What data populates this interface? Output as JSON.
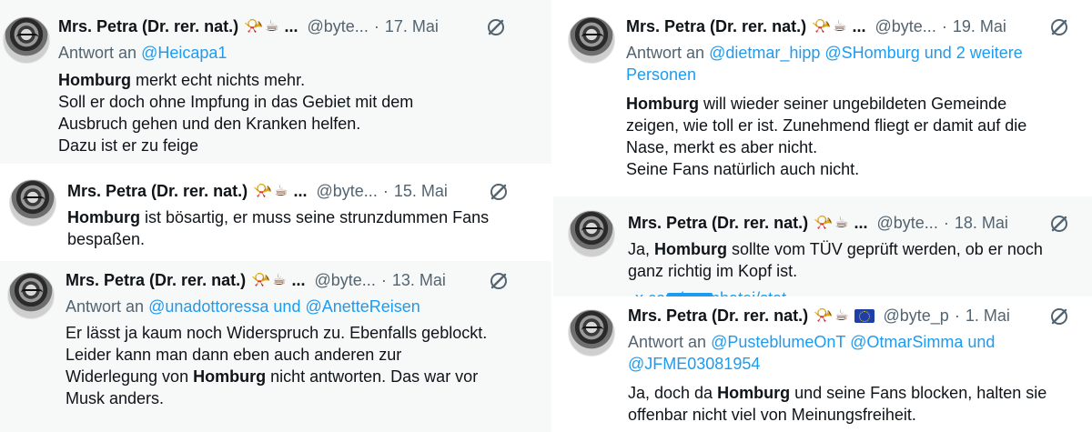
{
  "tweets": [
    {
      "name": "Mrs. Petra (Dr. rer. nat.)",
      "handle": "@byte...",
      "date": "17. Mai",
      "reply_prefix": "Antwort an",
      "reply_to": "@Heicapa1",
      "lines": [
        {
          "bold": "Homburg",
          "rest": " merkt echt nichts mehr."
        },
        {
          "bold": "",
          "rest": "Soll er doch ohne Impfung in das Gebiet mit dem"
        },
        {
          "bold": "",
          "rest": "Ausbruch gehen und den Kranken helfen."
        },
        {
          "bold": "",
          "rest": "Dazu ist er zu feige"
        }
      ]
    },
    {
      "name": "Mrs. Petra (Dr. rer. nat.)",
      "handle": "@byte...",
      "date": "15. Mai",
      "lines": [
        {
          "bold": "Homburg",
          "rest": " ist bösartig, er muss seine strunzdummen Fans"
        },
        {
          "bold": "",
          "rest": "bespaßen."
        }
      ]
    },
    {
      "name": "Mrs. Petra (Dr. rer. nat.)",
      "handle": "@byte...",
      "date": "13. Mai",
      "reply_prefix": "Antwort an",
      "reply_to": "@unadottoressa und @AnetteReisen",
      "lines": [
        {
          "pre": "Er lässt ja kaum noch Widerspruch zu. Ebenfalls geblockt.",
          "bold": "",
          "rest": ""
        },
        {
          "pre": "Leider kann man dann eben auch anderen zur",
          "bold": "",
          "rest": ""
        },
        {
          "pre": "Widerlegung von ",
          "bold": "Homburg",
          "rest": " nicht antworten. Das war vor"
        },
        {
          "pre": "Musk anders.",
          "bold": "",
          "rest": ""
        }
      ]
    },
    {
      "name": "Mrs. Petra (Dr. rer. nat.)",
      "handle": "@byte...",
      "date": "19. Mai",
      "reply_prefix": "Antwort an",
      "reply_to_line1": "@dietmar_hipp @SHomburg und 2 weitere",
      "reply_to_line2": "Personen",
      "lines": [
        {
          "bold": "Homburg",
          "rest": " will wieder seiner ungebildeten Gemeinde"
        },
        {
          "bold": "",
          "rest": "zeigen, wie toll er ist. Zunehmend fliegt er damit auf die"
        },
        {
          "bold": "",
          "rest": "Nase, merkt es aber nicht."
        },
        {
          "bold": "",
          "rest": "Seine Fans natürlich auch nicht."
        }
      ]
    },
    {
      "name": "Mrs. Petra (Dr. rer. nat.)",
      "handle": "@byte...",
      "date": "18. Mai",
      "lines": [
        {
          "pre": "Ja, ",
          "bold": "Homburg",
          "rest": " sollte vom TÜV geprüft werden, ob er noch"
        },
        {
          "pre": "ganz richtig im Kopf ist.",
          "bold": "",
          "rest": ""
        }
      ],
      "cut_link": "x.com/anonhatei/stat"
    },
    {
      "name": "Mrs. Petra (Dr. rer. nat.)",
      "handle": "@byte_p",
      "date": "1. Mai",
      "reply_prefix": "Antwort an",
      "reply_to_line1": "@PusteblumeOnT @OtmarSimma und",
      "reply_to_line2": "@JFME03081954",
      "lines": [
        {
          "pre": "Ja, doch da ",
          "bold": "Homburg",
          "rest": " und seine Fans blocken, halten sie"
        },
        {
          "pre": "offenbar nicht viel von Meinungsfreiheit.",
          "bold": "",
          "rest": ""
        }
      ]
    }
  ],
  "emoji": {
    "horn": "📯",
    "coffee": "☕"
  },
  "icons": {
    "grok": "slashed-circle-icon",
    "flag": "eu-flag-icon"
  },
  "colors": {
    "link": "#1d9bf0",
    "muted": "#536471",
    "text": "#0f1419",
    "grey_bg": "#f7f9f9"
  },
  "ellipsis": "..."
}
